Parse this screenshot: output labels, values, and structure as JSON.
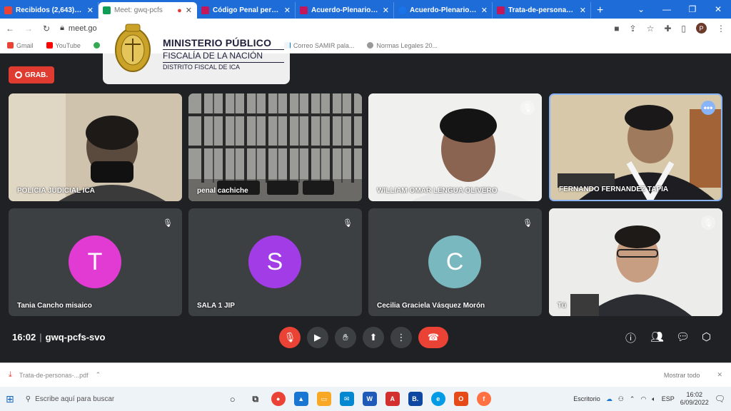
{
  "browser": {
    "tabs": [
      {
        "title": "Recibidos (2,643) - pe",
        "color": "#ea4335"
      },
      {
        "title": "Meet: gwq-pcfs",
        "color": "#0f9d58",
        "active": true
      },
      {
        "title": "Código Penal peruano",
        "color": "#c2185b"
      },
      {
        "title": "Acuerdo-Plenario-2-2",
        "color": "#c2185b"
      },
      {
        "title": "Acuerdo-Plenario-06-",
        "color": "#1a73e8"
      },
      {
        "title": "Trata-de-personas-an",
        "color": "#c2185b"
      }
    ],
    "url": "meet.go",
    "bookmarks": [
      "Gmail",
      "YouTube",
      "Correo SAMIR pala...",
      "Normas Legales 20..."
    ]
  },
  "logo": {
    "line1": "MINISTERIO PÚBLICO",
    "line2": "FISCALÍA DE LA NACIÓN",
    "line3": "DISTRITO FISCAL DE ICA"
  },
  "meet": {
    "recording_label": "GRAB.",
    "time": "16:02",
    "code": "gwq-pcfs-svo",
    "participants": [
      {
        "name": "POLICIA JUDICIAL ICA"
      },
      {
        "name": "penal cachiche"
      },
      {
        "name": "WILLIAM OMAR LENGUA OLIVERO"
      },
      {
        "name": "FERNANDO FERNANDEZ TAPIA"
      },
      {
        "name": "Tania Cancho misaico",
        "initial": "T",
        "color": "#e23bd3"
      },
      {
        "name": "SALA 1 JIP",
        "initial": "S",
        "color": "#a23ce6"
      },
      {
        "name": "Cecilia Graciela Vásquez Morón",
        "initial": "C",
        "color": "#7ab8bf"
      },
      {
        "name": "Tú"
      }
    ]
  },
  "download": {
    "file": "Trata-de-personas-...pdf",
    "show_all": "Mostrar todo"
  },
  "taskbar": {
    "search_placeholder": "Escribe aquí para buscar",
    "desktop_label": "Escritorio",
    "lang": "ESP",
    "time": "16:02",
    "date": "6/09/2022"
  }
}
